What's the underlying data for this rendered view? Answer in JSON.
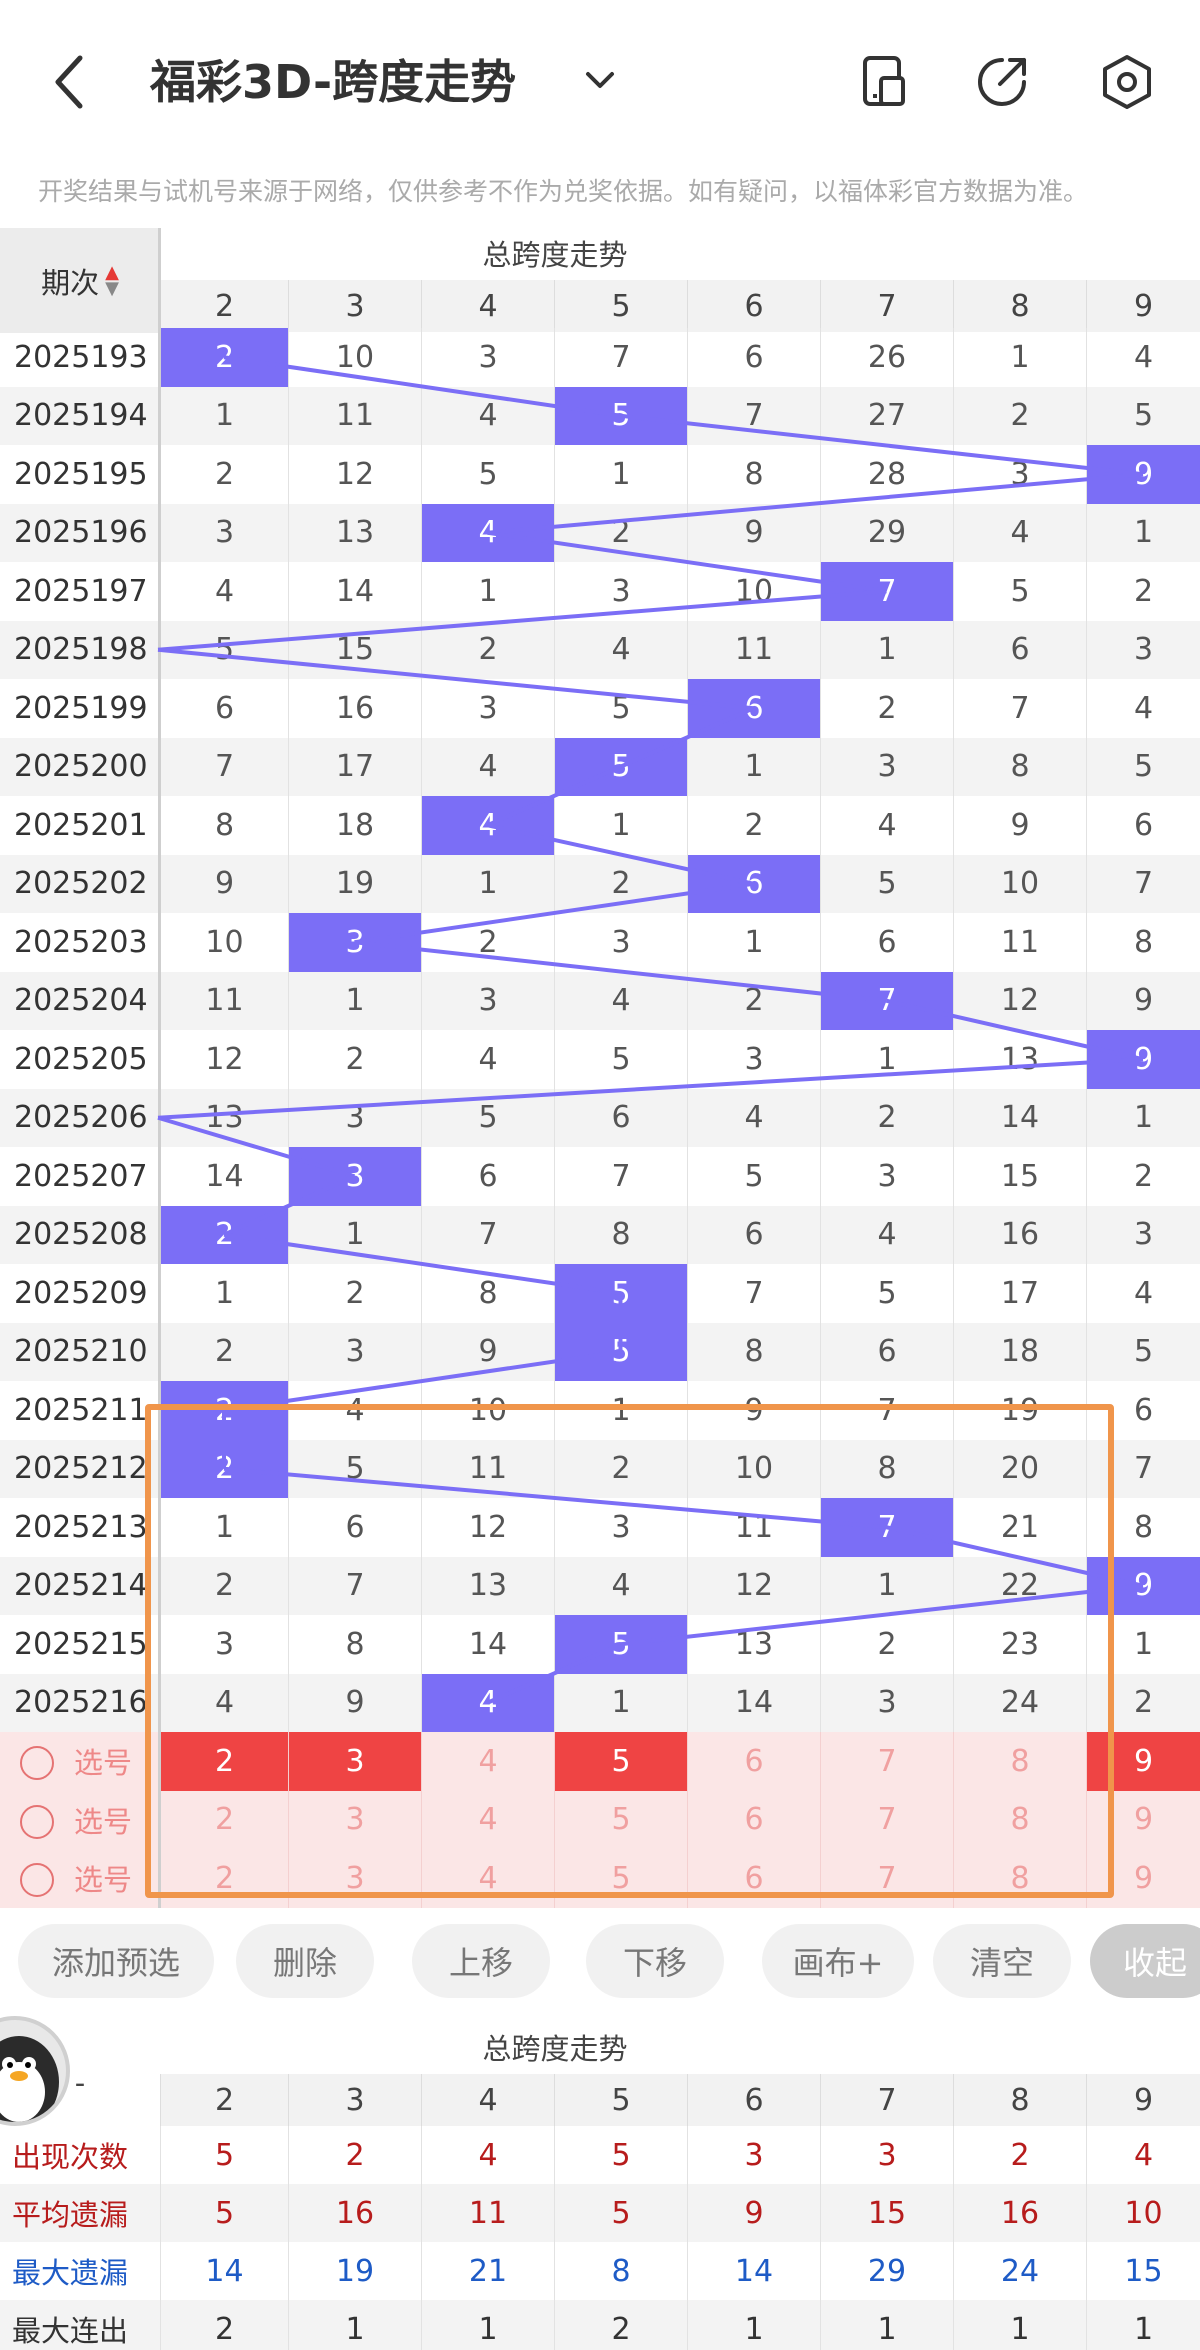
{
  "header": {
    "title": "福彩3D-跨度走势",
    "notice": "开奖结果与试机号来源于网络，仅供参考不作为兑奖依据。如有疑问，以福体彩官方数据为准。"
  },
  "icons": {
    "back": "back-arrow-icon",
    "dropdown": "chevron-down-icon",
    "phone": "phone-layout-icon",
    "share": "share-icon",
    "settings": "settings-icon"
  },
  "colors": {
    "hit": "#7b6ef6",
    "line": "#7b6ef6",
    "selected": "#ef4444",
    "highlight_box": "#f0954b"
  },
  "table": {
    "period_label": "期次",
    "section_title": "总跨度走势",
    "columns": [
      "2",
      "3",
      "4",
      "5",
      "6",
      "7",
      "8",
      "9"
    ],
    "rows": [
      {
        "period": "2025193",
        "hit": 2,
        "cells": [
          "2",
          "10",
          "3",
          "7",
          "6",
          "26",
          "1",
          "4"
        ]
      },
      {
        "period": "2025194",
        "hit": 5,
        "cells": [
          "1",
          "11",
          "4",
          "5",
          "7",
          "27",
          "2",
          "5"
        ]
      },
      {
        "period": "2025195",
        "hit": 9,
        "cells": [
          "2",
          "12",
          "5",
          "1",
          "8",
          "28",
          "3",
          "9"
        ]
      },
      {
        "period": "2025196",
        "hit": 4,
        "cells": [
          "3",
          "13",
          "4",
          "2",
          "9",
          "29",
          "4",
          "1"
        ]
      },
      {
        "period": "2025197",
        "hit": 7,
        "cells": [
          "4",
          "14",
          "1",
          "3",
          "10",
          "7",
          "5",
          "2"
        ]
      },
      {
        "period": "2025198",
        "hit": 1,
        "cells": [
          "5",
          "15",
          "2",
          "4",
          "11",
          "1",
          "6",
          "3"
        ]
      },
      {
        "period": "2025199",
        "hit": 6,
        "cells": [
          "6",
          "16",
          "3",
          "5",
          "6",
          "2",
          "7",
          "4"
        ]
      },
      {
        "period": "2025200",
        "hit": 5,
        "cells": [
          "7",
          "17",
          "4",
          "5",
          "1",
          "3",
          "8",
          "5"
        ]
      },
      {
        "period": "2025201",
        "hit": 4,
        "cells": [
          "8",
          "18",
          "4",
          "1",
          "2",
          "4",
          "9",
          "6"
        ]
      },
      {
        "period": "2025202",
        "hit": 6,
        "cells": [
          "9",
          "19",
          "1",
          "2",
          "6",
          "5",
          "10",
          "7"
        ]
      },
      {
        "period": "2025203",
        "hit": 3,
        "cells": [
          "10",
          "3",
          "2",
          "3",
          "1",
          "6",
          "11",
          "8"
        ]
      },
      {
        "period": "2025204",
        "hit": 7,
        "cells": [
          "11",
          "1",
          "3",
          "4",
          "2",
          "7",
          "12",
          "9"
        ]
      },
      {
        "period": "2025205",
        "hit": 9,
        "cells": [
          "12",
          "2",
          "4",
          "5",
          "3",
          "1",
          "13",
          "9"
        ]
      },
      {
        "period": "2025206",
        "hit": 1,
        "cells": [
          "13",
          "3",
          "5",
          "6",
          "4",
          "2",
          "14",
          "1"
        ]
      },
      {
        "period": "2025207",
        "hit": 3,
        "cells": [
          "14",
          "3",
          "6",
          "7",
          "5",
          "3",
          "15",
          "2"
        ]
      },
      {
        "period": "2025208",
        "hit": 2,
        "cells": [
          "2",
          "1",
          "7",
          "8",
          "6",
          "4",
          "16",
          "3"
        ]
      },
      {
        "period": "2025209",
        "hit": 5,
        "cells": [
          "1",
          "2",
          "8",
          "5",
          "7",
          "5",
          "17",
          "4"
        ]
      },
      {
        "period": "2025210",
        "hit": 5,
        "cells": [
          "2",
          "3",
          "9",
          "5",
          "8",
          "6",
          "18",
          "5"
        ]
      },
      {
        "period": "2025211",
        "hit": 2,
        "cells": [
          "2",
          "4",
          "10",
          "1",
          "9",
          "7",
          "19",
          "6"
        ]
      },
      {
        "period": "2025212",
        "hit": 2,
        "cells": [
          "2",
          "5",
          "11",
          "2",
          "10",
          "8",
          "20",
          "7"
        ]
      },
      {
        "period": "2025213",
        "hit": 7,
        "cells": [
          "1",
          "6",
          "12",
          "3",
          "11",
          "7",
          "21",
          "8"
        ]
      },
      {
        "period": "2025214",
        "hit": 9,
        "cells": [
          "2",
          "7",
          "13",
          "4",
          "12",
          "1",
          "22",
          "9"
        ]
      },
      {
        "period": "2025215",
        "hit": 5,
        "cells": [
          "3",
          "8",
          "14",
          "5",
          "13",
          "2",
          "23",
          "1"
        ]
      },
      {
        "period": "2025216",
        "hit": 4,
        "cells": [
          "4",
          "9",
          "4",
          "1",
          "14",
          "3",
          "24",
          "2"
        ]
      }
    ],
    "select_rows": [
      {
        "label": "选号",
        "selected": [
          true,
          true,
          false,
          true,
          false,
          false,
          false,
          true
        ]
      },
      {
        "label": "选号",
        "selected": [
          false,
          false,
          false,
          false,
          false,
          false,
          false,
          false
        ]
      },
      {
        "label": "选号",
        "selected": [
          false,
          false,
          false,
          false,
          false,
          false,
          false,
          false
        ]
      }
    ]
  },
  "toolbar": {
    "buttons": [
      "添加预选",
      "删除",
      "上移",
      "下移",
      "画布+",
      "清空",
      "收起"
    ]
  },
  "stats": {
    "section_title": "总跨度走势",
    "corner": "-",
    "columns": [
      "2",
      "3",
      "4",
      "5",
      "6",
      "7",
      "8",
      "9"
    ],
    "rows": [
      {
        "label": "出现次数",
        "label_color": "#b71c1c",
        "value_color": "#b71c1c",
        "values": [
          "5",
          "2",
          "4",
          "5",
          "3",
          "3",
          "2",
          "4"
        ]
      },
      {
        "label": "平均遗漏",
        "label_color": "#b71c1c",
        "value_color": "#b71c1c",
        "values": [
          "5",
          "16",
          "11",
          "5",
          "9",
          "15",
          "16",
          "10"
        ]
      },
      {
        "label": "最大遗漏",
        "label_color": "#1e5bc6",
        "value_color": "#1e5bc6",
        "values": [
          "14",
          "19",
          "21",
          "8",
          "14",
          "29",
          "24",
          "15"
        ]
      },
      {
        "label": "最大连出",
        "label_color": "#333333",
        "value_color": "#333333",
        "values": [
          "2",
          "1",
          "1",
          "2",
          "1",
          "1",
          "1",
          "1"
        ]
      }
    ]
  }
}
